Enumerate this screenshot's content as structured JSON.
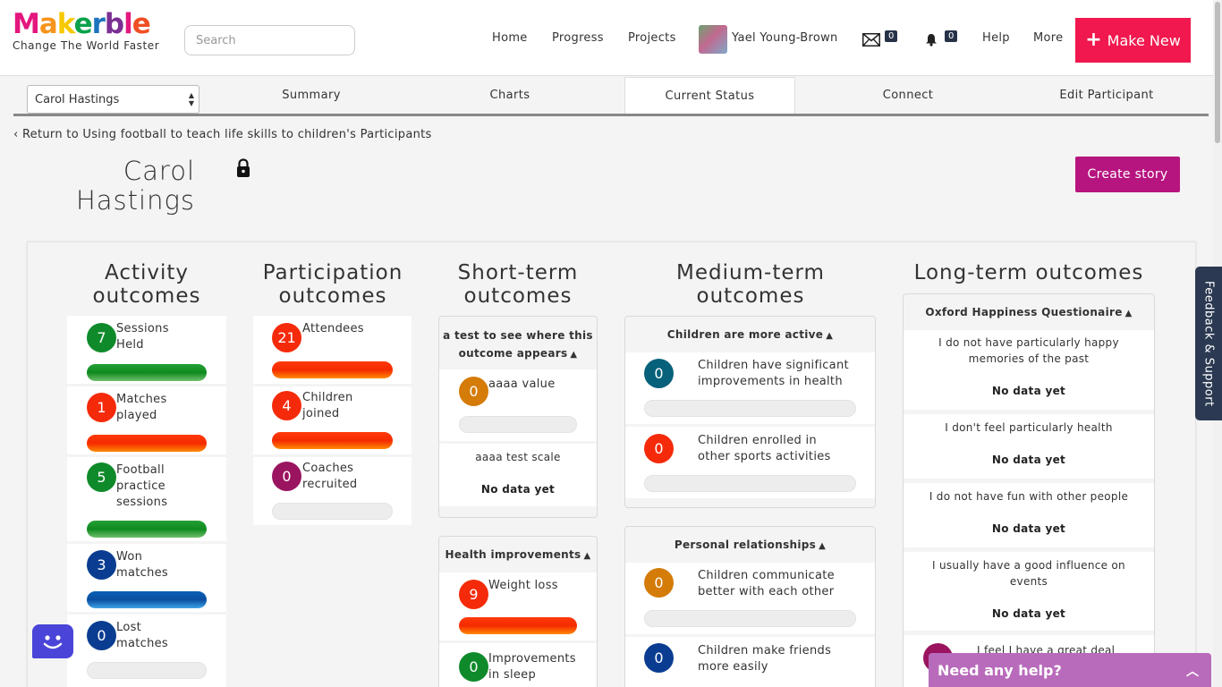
{
  "header": {
    "logo": "Makerble",
    "logo_letters": [
      "M",
      "a",
      "k",
      "e",
      "r",
      "b",
      "l",
      "e"
    ],
    "logo_colors": [
      "#e4177e",
      "#f7941d",
      "#f6c900",
      "#0aa14b",
      "#1e73be",
      "#7b2f93",
      "#e4177e",
      "#f04e23"
    ],
    "tagline": "Change The World Faster",
    "search_placeholder": "Search",
    "nav": {
      "home": "Home",
      "progress": "Progress",
      "projects": "Projects",
      "user_name": "Yael Young-Brown",
      "messages_count": "0",
      "notifications_count": "0",
      "help": "Help",
      "more": "More"
    },
    "make_new_label": "Make New",
    "make_new_color": "#f0184e"
  },
  "tabs": {
    "participant": "Carol Hastings",
    "summary": "Summary",
    "charts": "Charts",
    "current_status": "Current Status",
    "connect": "Connect",
    "edit": "Edit Participant"
  },
  "back_link": "Return to Using football to teach life skills to children's Participants",
  "participant_name_line1": "Carol",
  "participant_name_line2": "Hastings",
  "create_story_label": "Create story",
  "columns": {
    "activity": {
      "title_line1": "Activity",
      "title_line2": "outcomes",
      "items": [
        {
          "value": "7",
          "l1": "Sessions",
          "l2": "Held",
          "l3": ""
        },
        {
          "value": "1",
          "l1": "Matches",
          "l2": "played",
          "l3": ""
        },
        {
          "value": "5",
          "l1": "Football",
          "l2": "practice",
          "l3": "sessions"
        },
        {
          "value": "3",
          "l1": "Won",
          "l2": "matches",
          "l3": ""
        },
        {
          "value": "0",
          "l1": "Lost",
          "l2": "matches",
          "l3": ""
        }
      ]
    },
    "participation": {
      "title_line1": "Participation",
      "title_line2": "outcomes",
      "items": [
        {
          "value": "21",
          "l1": "Attendees",
          "l2": ""
        },
        {
          "value": "4",
          "l1": "Children",
          "l2": "joined"
        },
        {
          "value": "0",
          "l1": "Coaches",
          "l2": "recruited"
        }
      ]
    },
    "short_term": {
      "title_line1": "Short-term",
      "title_line2": "outcomes",
      "group1_line1": "a test to see where this",
      "group1_line2": "outcome appears",
      "item1": {
        "value": "0",
        "label": "aaaa value"
      },
      "scale_label": "aaaa test scale",
      "no_data": "No data yet",
      "group2": "Health improvements",
      "item2": {
        "value": "9",
        "label": "Weight loss"
      },
      "item3": {
        "value": "0",
        "l1": "Improvements",
        "l2": "in sleep"
      }
    },
    "medium_term": {
      "title_line1": "Medium-term",
      "title_line2": "outcomes",
      "group1": "Children are more active",
      "items1": [
        {
          "value": "0",
          "l1": "Children have significant",
          "l2": "improvements in health"
        },
        {
          "value": "0",
          "l1": "Children enrolled in",
          "l2": "other sports activities"
        }
      ],
      "group2": "Personal relationships",
      "items2": [
        {
          "value": "0",
          "l1": "Children communicate",
          "l2": "better with each other"
        },
        {
          "value": "0",
          "l1": "Children make friends",
          "l2": "more easily"
        }
      ]
    },
    "long_term": {
      "title": "Long-term outcomes",
      "group": "Oxford Happiness Questionaire",
      "no_data": "No data yet",
      "items": [
        {
          "l1": "I do not have particularly happy",
          "l2": "memories of the past"
        },
        {
          "l1": "I don't feel particularly health",
          "l2": ""
        },
        {
          "l1": "I do not have fun with other people",
          "l2": ""
        },
        {
          "l1": "I usually have a good influence on",
          "l2": "events"
        },
        {
          "l1": "I feel I have a great deal",
          "l2": ""
        }
      ]
    }
  },
  "feedback_label": "Feedback & Support",
  "help_label": "Need any help?",
  "status_colors": {
    "green": "#0f8a2a",
    "red": "#f52a0a",
    "blue": "#0a3d91",
    "purple": "#9a1460",
    "orange": "#d47b08",
    "teal": "#07617a"
  }
}
